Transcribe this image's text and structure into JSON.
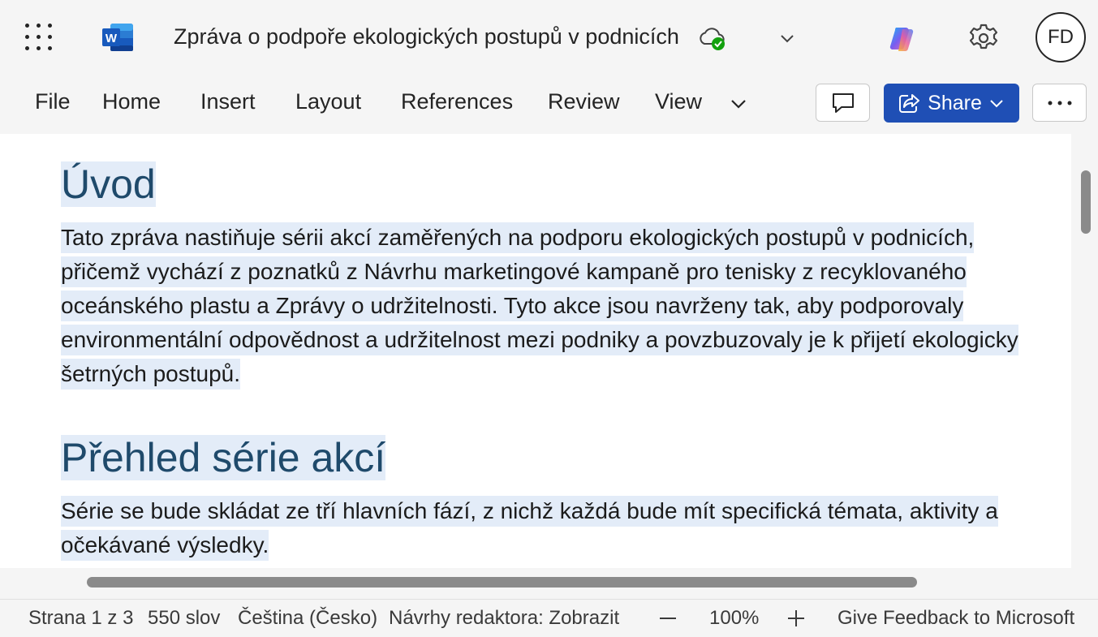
{
  "app": {
    "name": "Word",
    "logo_letter": "W"
  },
  "title_bar": {
    "document_title": "Zpráva o podpoře ekologických postupů v podnicích",
    "avatar_initials": "FD"
  },
  "ribbon": {
    "tabs": [
      "File",
      "Home",
      "Insert",
      "Layout",
      "References",
      "Review",
      "View"
    ],
    "share_label": "Share"
  },
  "document": {
    "sections": [
      {
        "heading": "Úvod",
        "paragraph": "Tato zpráva nastiňuje sérii akcí zaměřených na podporu ekologických postupů v podnicích, přičemž vychází z poznatků z Návrhu marketingové kampaně pro tenisky z recyklovaného oceánského plastu a Zprávy o udržitelnosti. Tyto akce jsou navrženy tak, aby podporovaly environmentální odpovědnost a udržitelnost mezi podniky a povzbuzovaly je k přijetí ekologicky šetrných postupů."
      },
      {
        "heading": "Přehled série akcí",
        "paragraph": "Série se bude skládat ze tří hlavních fází, z nichž každá bude mít specifická témata, aktivity a očekávané výsledky."
      }
    ]
  },
  "status_bar": {
    "page": "Strana 1 z 3",
    "words": "550 slov",
    "language": "Čeština (Česko)",
    "editor_suggestions": "Návrhy redaktora: Zobrazit",
    "zoom": "100%",
    "feedback": "Give Feedback to Microsoft"
  },
  "colors": {
    "accent": "#1f4fb5",
    "heading": "#1f4a6b",
    "selection": "#e3ecf8",
    "word_blue": "#185abd"
  }
}
